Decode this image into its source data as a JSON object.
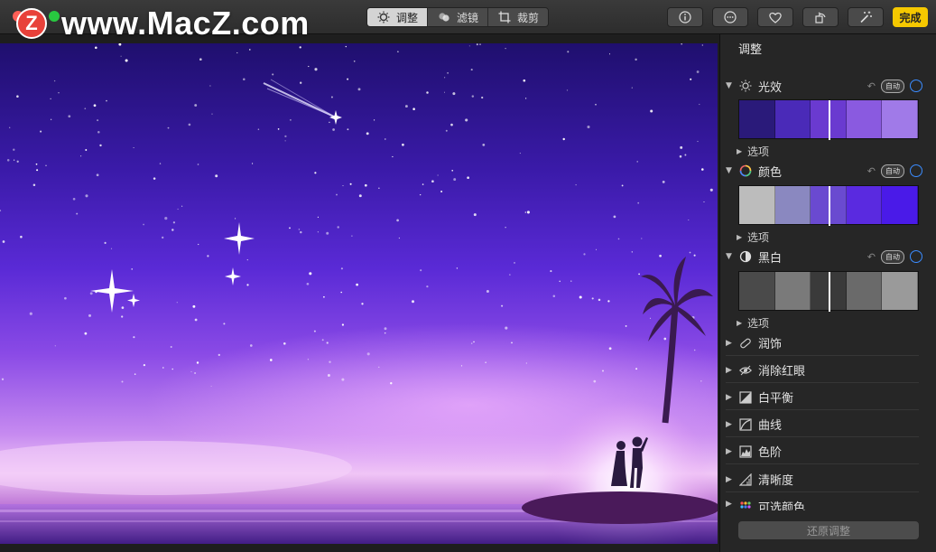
{
  "watermark": {
    "logo_letter": "Z",
    "text": "www.MacZ.com"
  },
  "toolbar": {
    "tabs": [
      {
        "label": "调整",
        "icon": "adjust-icon",
        "active": true
      },
      {
        "label": "滤镜",
        "icon": "filters-icon",
        "active": false
      },
      {
        "label": "裁剪",
        "icon": "crop-icon",
        "active": false
      }
    ],
    "buttons": [
      "info-icon",
      "more-icon",
      "heart-icon",
      "rotate-icon",
      "auto-enhance-icon"
    ],
    "done_label": "完成"
  },
  "sidebar": {
    "title": "调整",
    "auto_label": "自动",
    "options_label": "选项",
    "sections": [
      {
        "label": "光效",
        "icon": "sun-icon",
        "strip_colors": [
          "#2a1a7a",
          "#4a2ab8",
          "#6a3ad0",
          "#8a5ae0",
          "#a07ae8"
        ],
        "marker": 0.5
      },
      {
        "label": "颜色",
        "icon": "color-wheel-icon",
        "strip_colors": [
          "#bcbcbc",
          "#8a88c0",
          "#6a4ad0",
          "#5a2ae0",
          "#4a1ae8"
        ],
        "marker": 0.5
      },
      {
        "label": "黑白",
        "icon": "half-circle-icon",
        "strip_colors": [
          "#4a4a4a",
          "#7a7a7a",
          "#3a3a3a",
          "#6a6a6a",
          "#9a9a9a"
        ],
        "marker": 0.5
      }
    ],
    "tools": [
      {
        "label": "润饰",
        "icon": "bandage-icon"
      },
      {
        "label": "消除红眼",
        "icon": "eye-icon"
      },
      {
        "label": "白平衡",
        "icon": "white-balance-icon"
      },
      {
        "label": "曲线",
        "icon": "curves-icon"
      },
      {
        "label": "色阶",
        "icon": "levels-icon"
      },
      {
        "label": "清晰度",
        "icon": "definition-icon"
      },
      {
        "label": "可选颜色",
        "icon": "selective-color-icon"
      }
    ],
    "reset_label": "还原调整"
  },
  "colors": {
    "accent": "#3b8cff",
    "done": "#f5c800"
  }
}
